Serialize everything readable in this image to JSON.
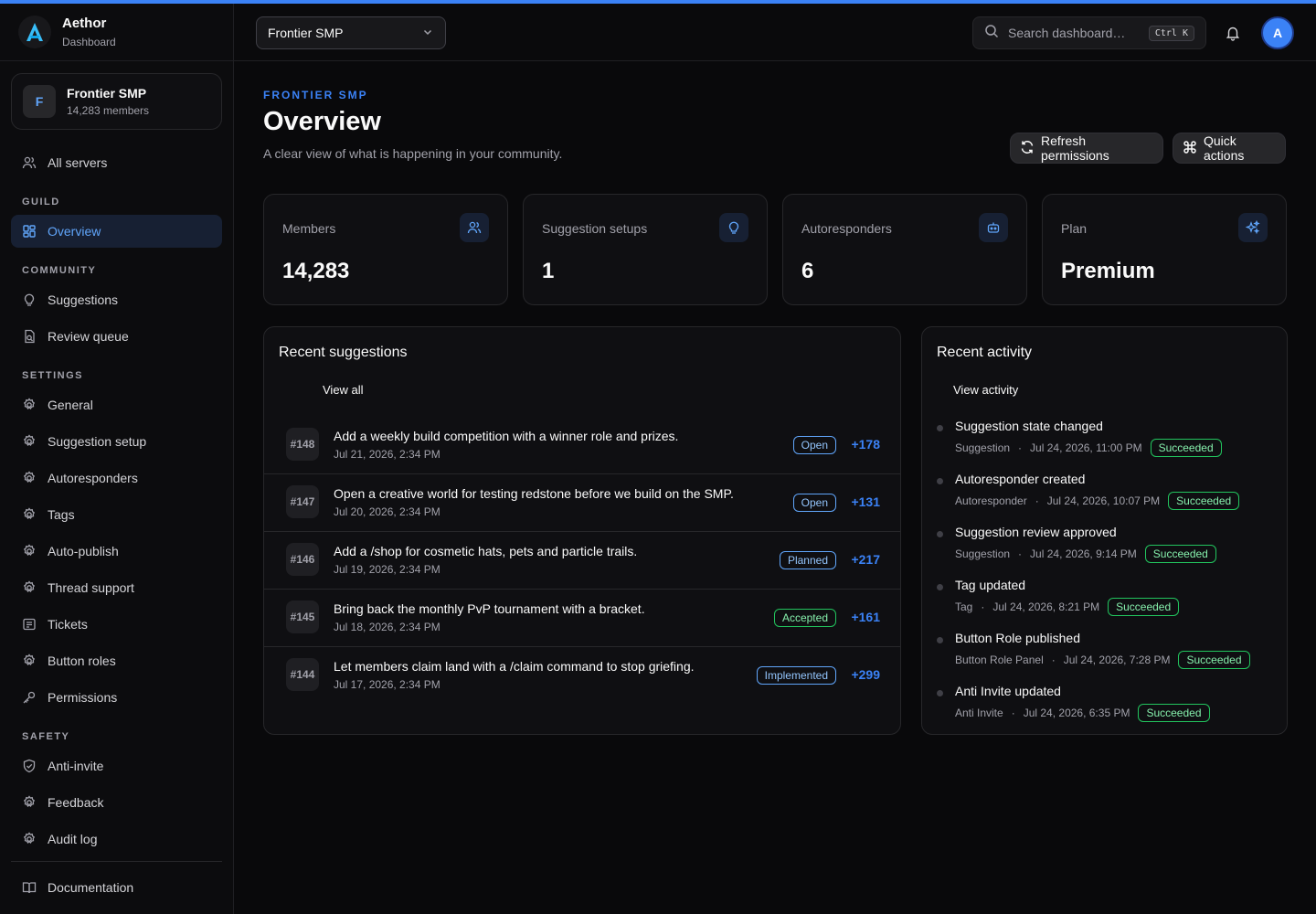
{
  "colors": {
    "accent": "#3b82f6",
    "background": "#09090b",
    "status_open": "#60a5fa",
    "status_accepted": "#22c55e",
    "status_succeeded": "#22c55e"
  },
  "brand": {
    "name": "Aethor",
    "subtitle": "Dashboard",
    "logo_icon": "aethor-logo-icon"
  },
  "sidebar": {
    "server": {
      "initial": "F",
      "name": "Frontier SMP",
      "members": "14,283 members"
    },
    "all_servers": {
      "label": "All servers",
      "icon": "users-icon"
    },
    "sections": [
      {
        "title": "GUILD",
        "items": [
          {
            "label": "Overview",
            "icon": "layout-dashboard-icon",
            "active": true
          }
        ]
      },
      {
        "title": "COMMUNITY",
        "items": [
          {
            "label": "Suggestions",
            "icon": "lightbulb-icon"
          },
          {
            "label": "Review queue",
            "icon": "review-queue-icon"
          }
        ]
      },
      {
        "title": "SETTINGS",
        "items": [
          {
            "label": "General",
            "icon": "gear-icon"
          },
          {
            "label": "Suggestion setup",
            "icon": "gear-icon"
          },
          {
            "label": "Autoresponders",
            "icon": "gear-icon"
          },
          {
            "label": "Tags",
            "icon": "gear-icon"
          },
          {
            "label": "Auto-publish",
            "icon": "gear-icon"
          },
          {
            "label": "Thread support",
            "icon": "gear-icon"
          },
          {
            "label": "Tickets",
            "icon": "ticket-message-icon"
          },
          {
            "label": "Button roles",
            "icon": "gear-icon"
          },
          {
            "label": "Permissions",
            "icon": "key-icon"
          }
        ]
      },
      {
        "title": "SAFETY",
        "items": [
          {
            "label": "Anti-invite",
            "icon": "shield-check-icon"
          },
          {
            "label": "Feedback",
            "icon": "gear-icon"
          },
          {
            "label": "Audit log",
            "icon": "gear-icon"
          }
        ]
      }
    ],
    "footer": {
      "label": "Documentation",
      "icon": "book-icon"
    }
  },
  "header": {
    "server_select": {
      "value": "Frontier SMP"
    },
    "search": {
      "placeholder": "Search dashboard…",
      "shortcut": "Ctrl K"
    },
    "avatar_initial": "A"
  },
  "page": {
    "eyebrow": "FRONTIER SMP",
    "title": "Overview",
    "subtitle": "A clear view of what is happening in your community.",
    "refresh_label": "Refresh permissions",
    "quick_label": "Quick actions"
  },
  "stats": [
    {
      "label": "Members",
      "value": "14,283",
      "icon": "users-icon"
    },
    {
      "label": "Suggestion setups",
      "value": "1",
      "icon": "lightbulb-icon"
    },
    {
      "label": "Autoresponders",
      "value": "6",
      "icon": "bot-icon"
    },
    {
      "label": "Plan",
      "value": "Premium",
      "icon": "sparkles-icon"
    }
  ],
  "suggestions": {
    "title": "Recent suggestions",
    "view_all": "View all",
    "rows": [
      {
        "id": "#148",
        "title": "Add a weekly build competition with a winner role and prizes.",
        "date": "Jul 21, 2026, 2:34 PM",
        "status": "Open",
        "votes": "+178"
      },
      {
        "id": "#147",
        "title": "Open a creative world for testing redstone before we build on the SMP.",
        "date": "Jul 20, 2026, 2:34 PM",
        "status": "Open",
        "votes": "+131"
      },
      {
        "id": "#146",
        "title": "Add a /shop for cosmetic hats, pets and particle trails.",
        "date": "Jul 19, 2026, 2:34 PM",
        "status": "Planned",
        "votes": "+217"
      },
      {
        "id": "#145",
        "title": "Bring back the monthly PvP tournament with a bracket.",
        "date": "Jul 18, 2026, 2:34 PM",
        "status": "Accepted",
        "votes": "+161"
      },
      {
        "id": "#144",
        "title": "Let members claim land with a /claim command to stop griefing.",
        "date": "Jul 17, 2026, 2:34 PM",
        "status": "Implemented",
        "votes": "+299"
      }
    ]
  },
  "activity": {
    "title": "Recent activity",
    "view_all": "View activity",
    "rows": [
      {
        "title": "Suggestion state changed",
        "module": "Suggestion",
        "time": "Jul 24, 2026, 11:00 PM",
        "status": "Succeeded"
      },
      {
        "title": "Autoresponder created",
        "module": "Autoresponder",
        "time": "Jul 24, 2026, 10:07 PM",
        "status": "Succeeded"
      },
      {
        "title": "Suggestion review approved",
        "module": "Suggestion",
        "time": "Jul 24, 2026, 9:14 PM",
        "status": "Succeeded"
      },
      {
        "title": "Tag updated",
        "module": "Tag",
        "time": "Jul 24, 2026, 8:21 PM",
        "status": "Succeeded"
      },
      {
        "title": "Button Role published",
        "module": "Button Role Panel",
        "time": "Jul 24, 2026, 7:28 PM",
        "status": "Succeeded"
      },
      {
        "title": "Anti Invite updated",
        "module": "Anti Invite",
        "time": "Jul 24, 2026, 6:35 PM",
        "status": "Succeeded"
      }
    ]
  }
}
